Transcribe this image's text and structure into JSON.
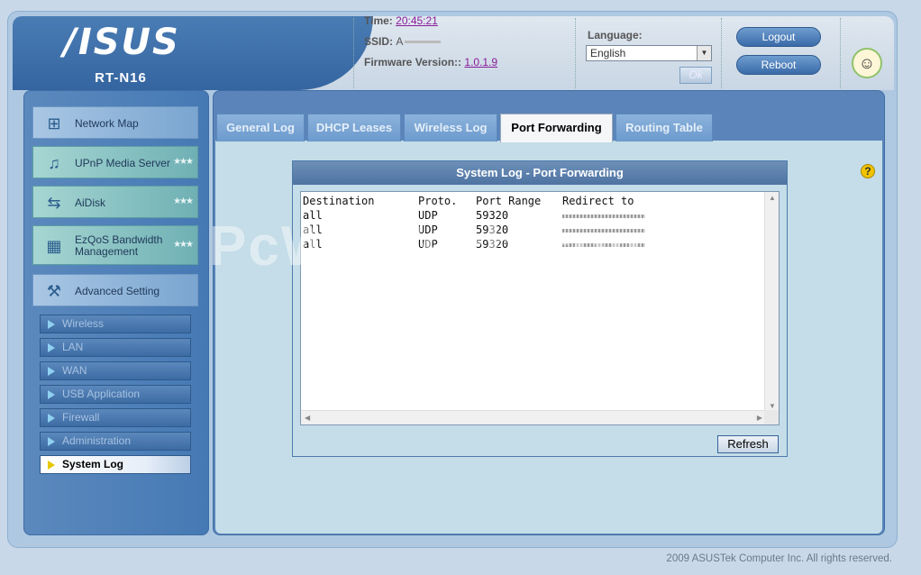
{
  "header": {
    "brand": "/ISUS",
    "model": "RT-N16",
    "time_label": "Time:",
    "time_value": "20:45:21",
    "ssid_label": "SSID:",
    "ssid_value": "A",
    "firmware_label": "Firmware Version::",
    "firmware_value": "1.0.1.9",
    "language_label": "Language:",
    "language_selected": "English",
    "ok_label": "Ok",
    "logout_label": "Logout",
    "reboot_label": "Reboot"
  },
  "sidebar": {
    "items": [
      {
        "label": "Network Map",
        "icon": "network-map-icon"
      },
      {
        "label": "UPnP Media Server",
        "icon": "media-server-icon"
      },
      {
        "label": "AiDisk",
        "icon": "aidisk-icon"
      },
      {
        "label": "EzQoS Bandwidth Management",
        "icon": "ezqos-icon"
      },
      {
        "label": "Advanced Setting",
        "icon": "advanced-setting-icon"
      }
    ],
    "sub_items": [
      "Wireless",
      "LAN",
      "WAN",
      "USB Application",
      "Firewall",
      "Administration",
      "System Log"
    ],
    "active_sub": "System Log"
  },
  "tabs": [
    "General Log",
    "DHCP Leases",
    "Wireless Log",
    "Port Forwarding",
    "Routing Table"
  ],
  "active_tab": "Port Forwarding",
  "panel": {
    "title": "System Log - Port Forwarding",
    "columns": [
      "Destination",
      "Proto.",
      "Port Range",
      "Redirect to"
    ],
    "rows": [
      [
        "all",
        "UDP",
        "59320",
        ""
      ],
      [
        "all",
        "UDP",
        "59320",
        ""
      ],
      [
        "all",
        "UDP",
        "59320",
        ""
      ]
    ],
    "refresh_label": "Refresh"
  },
  "watermark": "PcWinTech.com",
  "footer": "2009 ASUSTek Computer Inc. All rights reserved.",
  "colors": {
    "accent": "#3a6ba8",
    "content_bg": "#c4dde8",
    "link": "#8a1c9a"
  }
}
